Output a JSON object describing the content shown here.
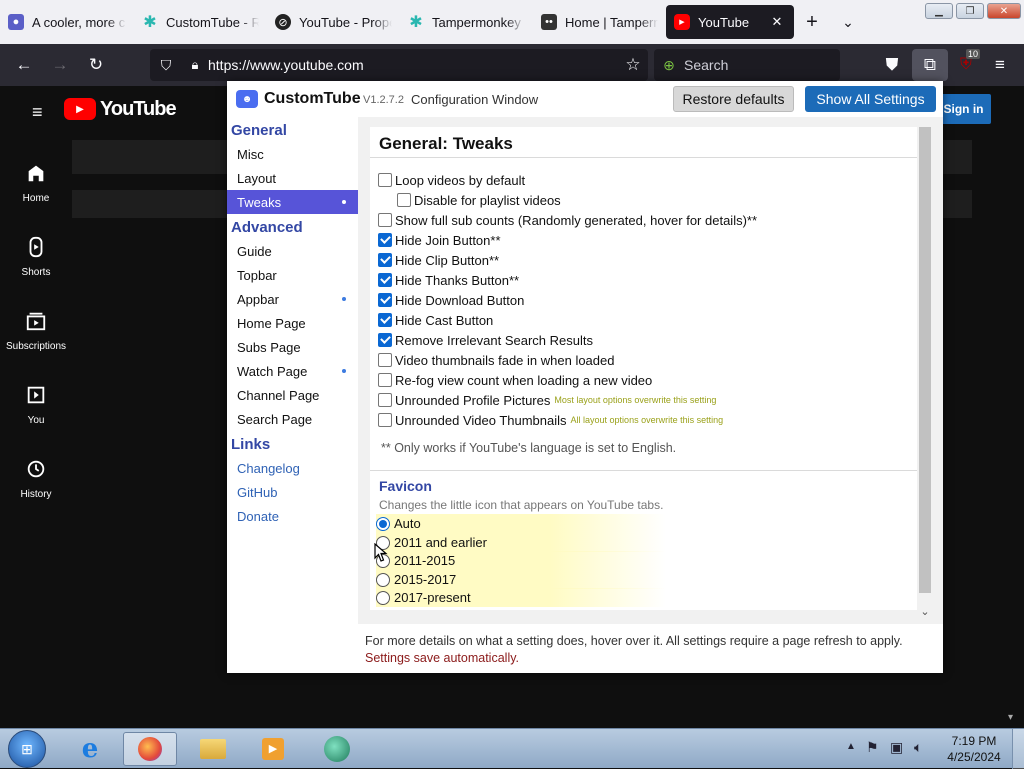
{
  "browser": {
    "tabs": [
      {
        "label": "A cooler, more c",
        "icon": "chat-icon",
        "color": "#5b5fc7"
      },
      {
        "label": "CustomTube - R",
        "icon": "customtube-icon",
        "color": "#2ab7b0"
      },
      {
        "label": "YouTube - Prope",
        "icon": "blocked-icon",
        "color": "#222222"
      },
      {
        "label": "Tampermonkey -",
        "icon": "customtube-icon",
        "color": "#2ab7b0"
      },
      {
        "label": "Home | Tamperm",
        "icon": "tampermonkey-icon",
        "color": "#333333"
      },
      {
        "label": "YouTube",
        "icon": "youtube-icon",
        "color": "#ff0000"
      }
    ],
    "active_tab_close": "✕",
    "url": "https://www.youtube.com",
    "search_placeholder": "Search",
    "extension_badge": "10"
  },
  "youtube": {
    "logo_text": "YouTube",
    "sign_in": "Sign in",
    "nav": [
      {
        "label": "Home"
      },
      {
        "label": "Shorts"
      },
      {
        "label": "Subscriptions"
      },
      {
        "label": "You"
      },
      {
        "label": "History"
      }
    ]
  },
  "config": {
    "brand": "CustomTube",
    "version": "V1.2.7.2",
    "window_title": "Configuration Window",
    "restore_label": "Restore defaults",
    "show_all_label": "Show All Settings",
    "nav": {
      "general_header": "General",
      "general_items": [
        "Misc",
        "Layout",
        "Tweaks"
      ],
      "advanced_header": "Advanced",
      "advanced_items": [
        "Guide",
        "Topbar",
        "Appbar",
        "Home Page",
        "Subs Page",
        "Watch Page",
        "Channel Page",
        "Search Page"
      ],
      "links_header": "Links",
      "link_items": [
        "Changelog",
        "GitHub",
        "Donate"
      ]
    },
    "section_title": "General: Tweaks",
    "options": [
      {
        "label": "Loop videos by default",
        "checked": false
      },
      {
        "label": "Disable for playlist videos",
        "checked": false
      },
      {
        "label": "Show full sub counts (Randomly generated, hover for details)**",
        "checked": false
      },
      {
        "label": "Hide Join Button**",
        "checked": true
      },
      {
        "label": "Hide Clip Button**",
        "checked": true
      },
      {
        "label": "Hide Thanks Button**",
        "checked": true
      },
      {
        "label": "Hide Download Button",
        "checked": true
      },
      {
        "label": "Hide Cast Button",
        "checked": true
      },
      {
        "label": "Remove Irrelevant Search Results",
        "checked": true
      },
      {
        "label": "Video thumbnails fade in when loaded",
        "checked": false
      },
      {
        "label": "Re-fog view count when loading a new video",
        "checked": false
      },
      {
        "label": "Unrounded Profile Pictures",
        "checked": false,
        "note": "Most layout options overwrite this setting"
      },
      {
        "label": "Unrounded Video Thumbnails",
        "checked": false,
        "note": "All layout options overwrite this setting"
      }
    ],
    "footnote": "** Only works if YouTube's language is set to English.",
    "favicon": {
      "title": "Favicon",
      "description": "Changes the little icon that appears on YouTube tabs.",
      "choices": [
        {
          "label": "Auto",
          "selected": true
        },
        {
          "label": "2011 and earlier",
          "selected": false
        },
        {
          "label": "2011-2015",
          "selected": false
        },
        {
          "label": "2015-2017",
          "selected": false
        },
        {
          "label": "2017-present",
          "selected": false
        }
      ]
    },
    "footer_info": "For more details on what a setting does, hover over it. All settings require a page refresh to apply.",
    "footer_save": "Settings save automatically."
  },
  "taskbar": {
    "time": "7:19 PM",
    "date": "4/25/2024"
  },
  "colors": {
    "accent": "#5754d8",
    "brand_blue": "#3347a4",
    "primary_button": "#1c6bb8",
    "save_red": "#8b1a1a"
  }
}
